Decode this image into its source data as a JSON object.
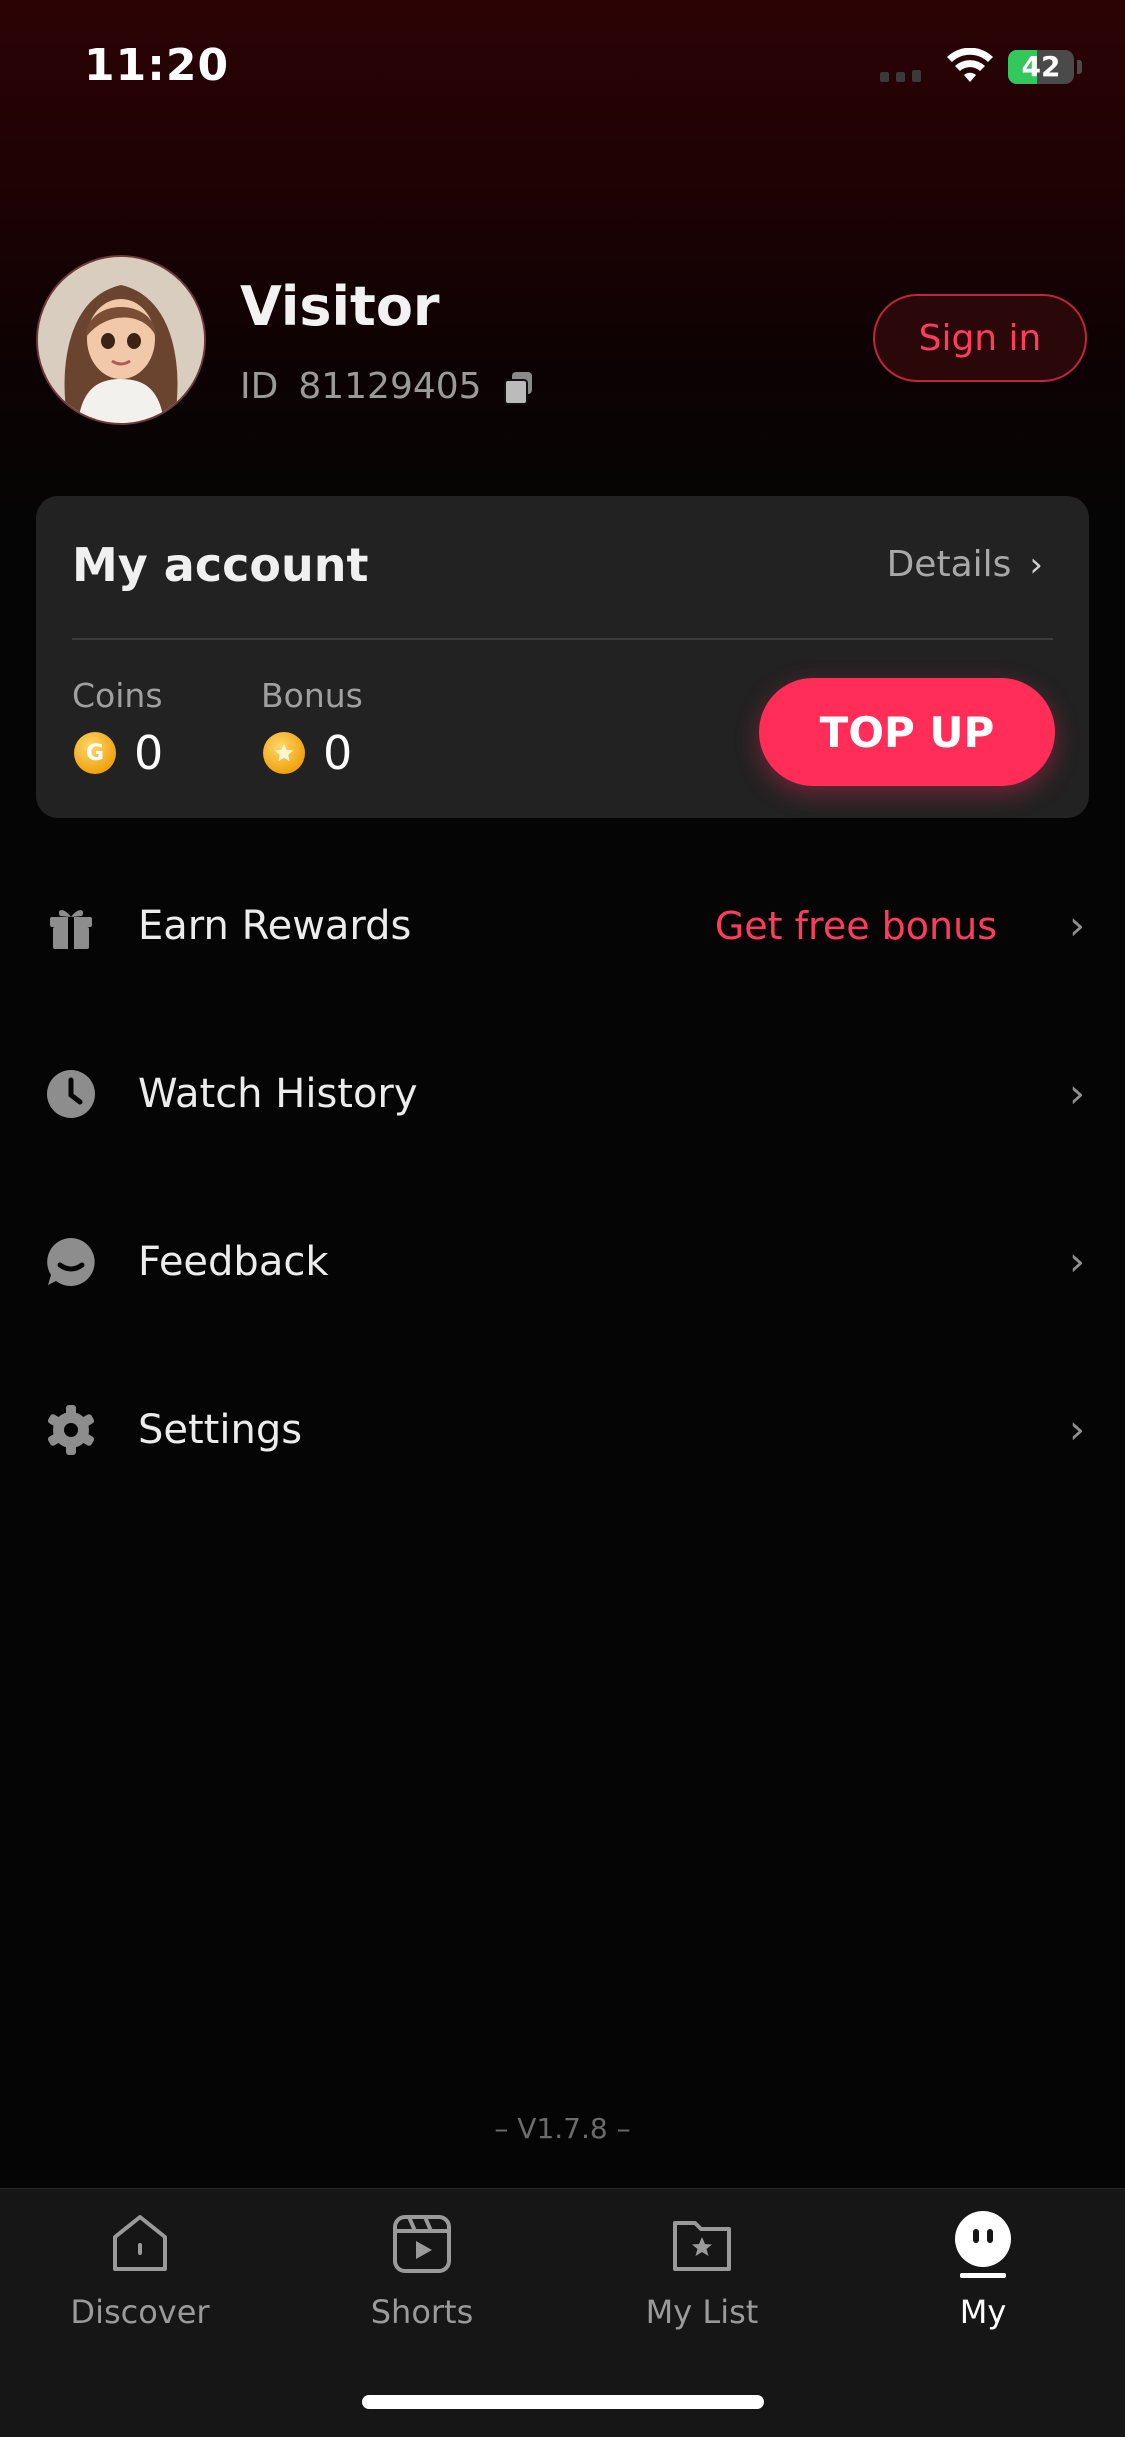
{
  "status_bar": {
    "time": "11:20",
    "battery": "42"
  },
  "profile": {
    "name": "Visitor",
    "id_label": "ID",
    "id_value": "81129405",
    "sign_in": "Sign in"
  },
  "account": {
    "title": "My account",
    "details": "Details",
    "coins_label": "Coins",
    "coins_value": "0",
    "bonus_label": "Bonus",
    "bonus_value": "0",
    "top_up": "TOP UP"
  },
  "menu": [
    {
      "label": "Earn Rewards",
      "extra": "Get free bonus",
      "icon": "gift-icon"
    },
    {
      "label": "Watch History",
      "icon": "clock-icon"
    },
    {
      "label": "Feedback",
      "icon": "chat-bubble-icon"
    },
    {
      "label": "Settings",
      "icon": "gear-icon"
    }
  ],
  "version": "– V1.7.8 –",
  "tabs": [
    {
      "label": "Discover",
      "icon": "house-icon"
    },
    {
      "label": "Shorts",
      "icon": "play-clapper-icon"
    },
    {
      "label": "My List",
      "icon": "star-folder-icon"
    },
    {
      "label": "My",
      "icon": "face-icon",
      "active": true
    }
  ],
  "colors": {
    "accent": "#ff2d57",
    "background": "#050505",
    "card": "#222223"
  }
}
